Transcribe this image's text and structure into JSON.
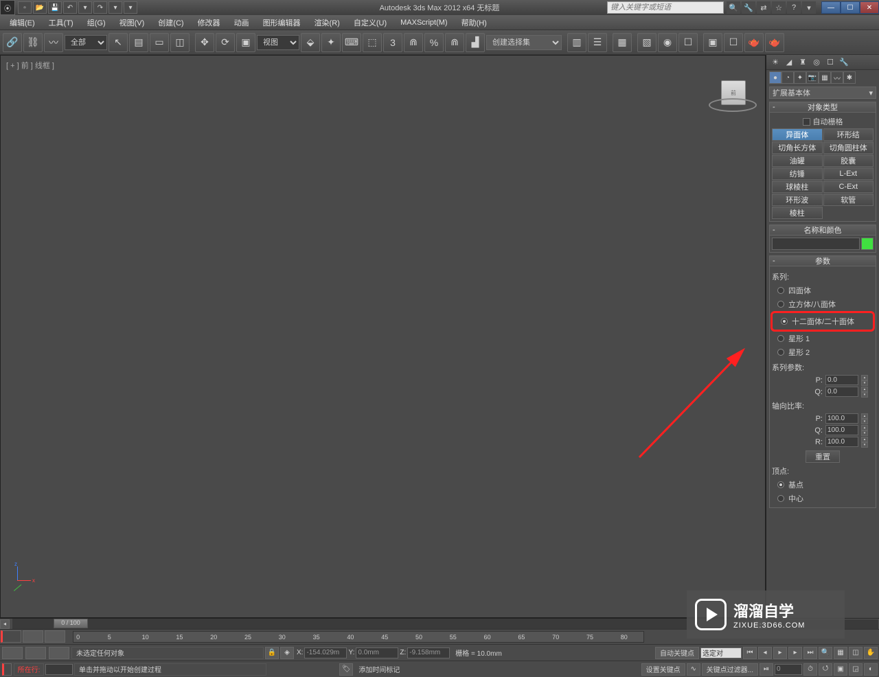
{
  "title": {
    "app_full": "Autodesk 3ds Max 2012 x64   无标题",
    "search_placeholder": "键入关键字或短语"
  },
  "menu": [
    "编辑(E)",
    "工具(T)",
    "组(G)",
    "视图(V)",
    "创建(C)",
    "修改器",
    "动画",
    "图形编辑器",
    "渲染(R)",
    "自定义(U)",
    "MAXScript(M)",
    "帮助(H)"
  ],
  "toolbar": {
    "filter_all": "全部",
    "view_select": "视图",
    "selection_set": "创建选择集"
  },
  "viewport": {
    "label": "[ + ] 前 ] 线框 ]",
    "cube": "前"
  },
  "panel": {
    "category": "扩展基本体",
    "rollout_object_type": "对象类型",
    "autogrid": "自动栅格",
    "buttons": {
      "hedra": "异面体",
      "torusknot": "环形结",
      "chamferbox": "切角长方体",
      "chamfercyl": "切角圆柱体",
      "oiltank": "油罐",
      "capsule": "胶囊",
      "spindle": "纺锤",
      "lext": "L-Ext",
      "gengon": "球棱柱",
      "cext": "C-Ext",
      "ringwave": "环形波",
      "hose": "软管",
      "prism": "棱柱"
    },
    "rollout_name_color": "名称和颜色",
    "rollout_params": "参数",
    "family_label": "系列:",
    "family": {
      "tetra": "四面体",
      "cube_octa": "立方体/八面体",
      "dodec_icos": "十二面体/二十面体",
      "star1": "星形 1",
      "star2": "星形 2"
    },
    "family_params_label": "系列参数:",
    "p_label": "P:",
    "p_val": "0.0",
    "q_label": "Q:",
    "q_val": "0.0",
    "axis_scale_label": "轴向比率:",
    "ap_label": "P:",
    "ap_val": "100.0",
    "aq_label": "Q:",
    "aq_val": "100.0",
    "ar_label": "R:",
    "ar_val": "100.0",
    "reset": "重置",
    "vertex_label": "顶点:",
    "vertex_base": "基点",
    "vertex_center": "中心"
  },
  "timeline": {
    "slider_text": "0 / 100",
    "ticks": [
      "0",
      "5",
      "10",
      "15",
      "20",
      "25",
      "30",
      "35",
      "40",
      "45",
      "50",
      "55",
      "60",
      "65",
      "70",
      "75",
      "80"
    ]
  },
  "statusbar": {
    "no_selection": "未选定任何对象",
    "prompt": "单击并拖动以开始创建过程",
    "x": "-154.029m",
    "y": "0.0mm",
    "z": "-9.158mm",
    "grid": "栅格 = 10.0mm",
    "auto_key": "自动关键点",
    "set_key": "设置关键点",
    "sel_set": "选定对",
    "key_filters": "关键点过滤器...",
    "row_label": "所在行:",
    "add_time_tag": "添加时间标记",
    "frame_value": "0"
  },
  "watermark": {
    "title": "溜溜自学",
    "url": "ZIXUE.3D66.COM"
  }
}
